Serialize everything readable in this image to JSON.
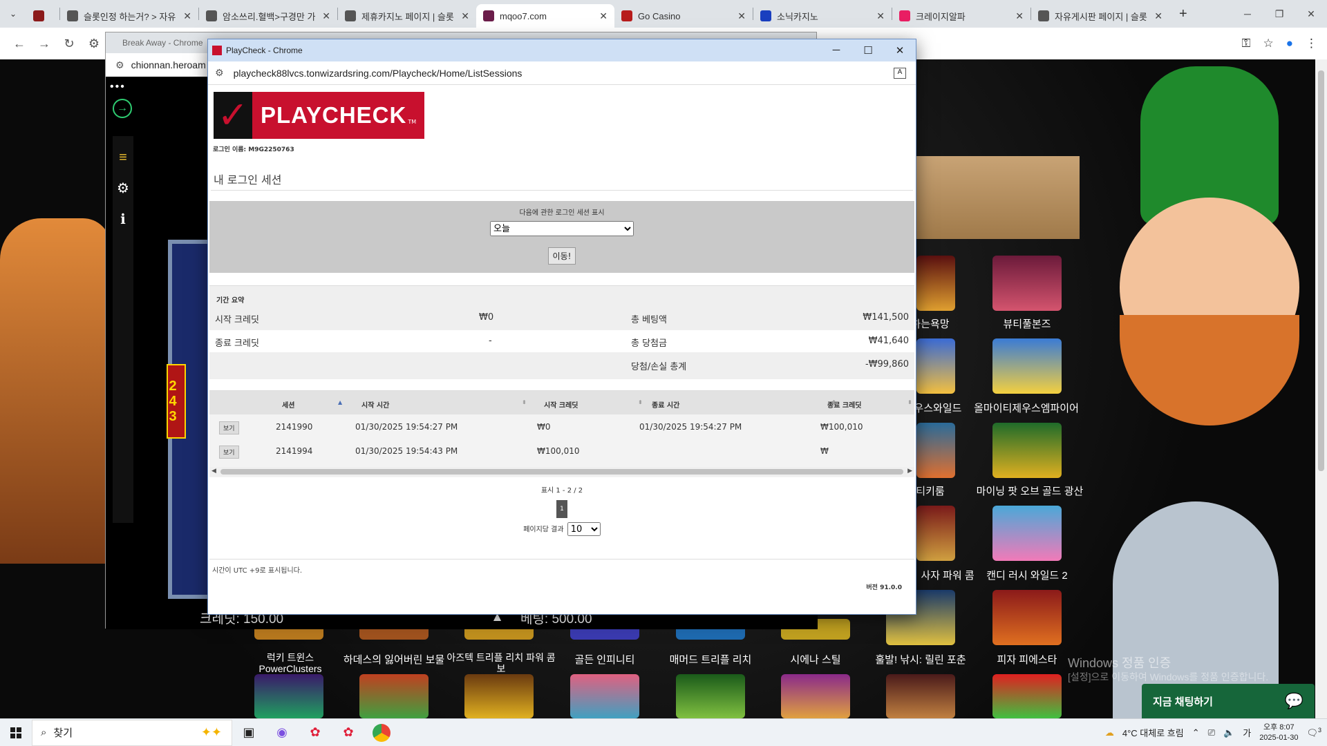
{
  "browser": {
    "tabs": [
      {
        "title": "",
        "color": "#8b1a1a",
        "short": true
      },
      {
        "title": "슬롯인정 하는거? > 자유",
        "color": "#555555"
      },
      {
        "title": "암소쓰리.혈백>구경만 가",
        "color": "#555555"
      },
      {
        "title": "제휴카지노 페이지 | 슬롯",
        "color": "#555555"
      },
      {
        "title": "mqoo7.com",
        "color": "#6b1d4a",
        "active": true
      },
      {
        "title": "Go Casino",
        "color": "#b71c1c"
      },
      {
        "title": "소닉카지노",
        "color": "#1a3fbf"
      },
      {
        "title": "크레이지알파",
        "color": "#e91e63"
      },
      {
        "title": "자유게시판 페이지 | 슬롯",
        "color": "#555555"
      }
    ],
    "new_tab": "+",
    "close": "✕"
  },
  "background_window": {
    "title": "Break Away - Chrome",
    "url": "chionnan.heroam",
    "slot_number": "243",
    "credit_label": "크레딧: 150.00",
    "bet_label": "베팅: 500.00"
  },
  "casino": {
    "game_names": [
      "뷰티풀본즈",
      "올마이티제우스엠파이어",
      "마이닝 팟 오브 골드 광산",
      "캔디 러시 와일드 2",
      "피자 피에스타",
      "하는욕망",
      "제우스와일드",
      "티키룸",
      "사자 파워 콤",
      "럭키 트윈스 PowerClusters",
      "하데스의 잃어버린 보물",
      "아즈텍 트리플 리치 파워 콤보",
      "골든 인피니티",
      "매머드 트리플 리치",
      "시에나 스틸",
      "훌발! 낚시: 릴린 포춘"
    ],
    "chat_button": "지금 채팅하기",
    "watermark_title": "Windows 정품 인증",
    "watermark_sub": "[설정]으로 이동하여 Windows를 정품 인증합니다."
  },
  "playcheck": {
    "window_title": "PlayCheck - Chrome",
    "url": "playcheck88lvcs.tonwizardsring.com/Playcheck/Home/ListSessions",
    "logo_text": "PLAYCHECK",
    "login_name": "로그인 이름: M9G2250763",
    "section_title": "내 로그인 세션",
    "filter_label": "다음에 관한 로그인 세션 표시",
    "filter_value": "오늘",
    "go_button": "이동!",
    "summary": {
      "heading": "기간 요약",
      "start_credit_label": "시작 크레딧",
      "start_credit_value": "₩0",
      "end_credit_label": "종료 크레딧",
      "end_credit_value": "-",
      "total_bet_label": "총 베팅액",
      "total_bet_value": "₩141,500",
      "total_win_label": "총 당첨금",
      "total_win_value": "₩41,640",
      "net_label": "당첨/손실 총계",
      "net_value": "-₩99,860"
    },
    "table": {
      "headers": [
        "세션",
        "시작 시간",
        "시작 크레딧",
        "종료 시간",
        "종료 크레딧"
      ],
      "view_label": "보기",
      "rows": [
        {
          "session": "2141990",
          "start_time": "01/30/2025 19:54:27 PM",
          "start_credit": "₩0",
          "end_time": "01/30/2025 19:54:27 PM",
          "end_credit": "₩100,010"
        },
        {
          "session": "2141994",
          "start_time": "01/30/2025 19:54:43 PM",
          "start_credit": "₩100,010",
          "end_time": "",
          "end_credit": "₩"
        }
      ]
    },
    "pager": {
      "range": "표시 1 - 2 / 2",
      "current_page": "1",
      "per_page_label": "페이지당 결과",
      "per_page_value": "10"
    },
    "timezone_note": "시간이 UTC +9로 표시됩니다.",
    "version": "버전 91.0.0"
  },
  "taskbar": {
    "search_placeholder": "찾기",
    "weather": "4°C  대체로 흐림",
    "time": "오후 8:07",
    "date": "2025-01-30",
    "notification_count": "3"
  }
}
